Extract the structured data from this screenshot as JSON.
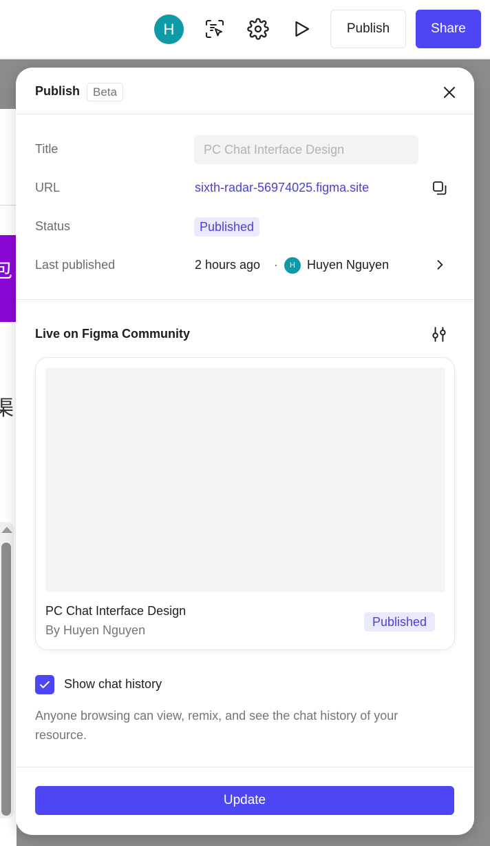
{
  "toolbar": {
    "avatar_initial": "H",
    "publish_label": "Publish",
    "share_label": "Share",
    "icons": [
      "inspect-icon",
      "gear-icon",
      "play-icon"
    ]
  },
  "background": {
    "glyph_1": "包",
    "glyph_2": "渠"
  },
  "panel": {
    "title": "Publish",
    "badge": "Beta",
    "fields": {
      "title_label": "Title",
      "title_placeholder": "PC Chat Interface Design",
      "url_label": "URL",
      "url_value": "sixth-radar-56974025.figma.site",
      "status_label": "Status",
      "status_value": "Published",
      "last_published_label": "Last published",
      "last_published_time": "2 hours ago",
      "separator": "·",
      "user_initial": "H",
      "user_name": "Huyen Nguyen"
    },
    "community": {
      "title": "Live on Figma Community",
      "card_name": "PC Chat Interface Design",
      "card_author": "By Huyen Nguyen",
      "card_status": "Published"
    },
    "chat_history": {
      "checked": true,
      "label": "Show chat history",
      "description": "Anyone browsing can view, remix, and see the chat history of your resource."
    },
    "update_label": "Update"
  },
  "colors": {
    "accent": "#4c46f5",
    "avatar": "#0f9aa8",
    "link": "#4a42d8",
    "badge_bg": "#ebeafd"
  }
}
